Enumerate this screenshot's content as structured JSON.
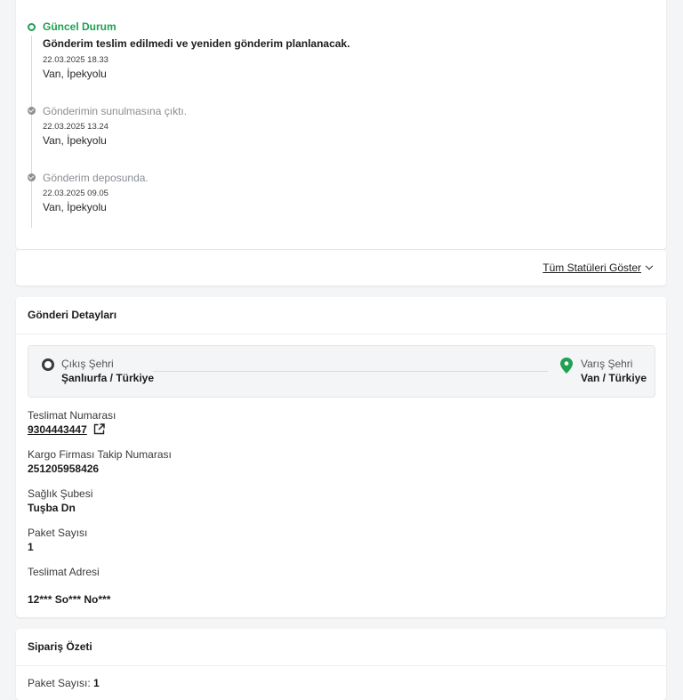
{
  "timeline": {
    "current": {
      "title": "Güncel Durum",
      "message": "Gönderim teslim edilmedi ve yeniden gönderim planlanacak.",
      "time": "22.03.2025 18.33",
      "location": "Van, İpekyolu"
    },
    "items": [
      {
        "title": "Gönderimin sunulmasına çıktı.",
        "time": "22.03.2025 13.24",
        "location": "Van, İpekyolu"
      },
      {
        "title": "Gönderim deposunda.",
        "time": "22.03.2025 09.05",
        "location": "Van, İpekyolu"
      }
    ]
  },
  "show_all_label": "Tüm Statüleri Göster",
  "details": {
    "header": "Gönderi Detayları",
    "origin_label": "Çıkış Şehri",
    "origin_value": "Şanlıurfa / Türkiye",
    "destination_label": "Varış Şehri",
    "destination_value": "Van / Türkiye",
    "fields": {
      "delivery_number_label": "Teslimat Numarası",
      "delivery_number_value": "9304443447",
      "tracking_label": "Kargo Firması Takip Numarası",
      "tracking_value": "251205958426",
      "branch_label": "Sağlık Şubesi",
      "branch_value": "Tuşba Dn",
      "package_count_label": "Paket Sayısı",
      "package_count_value": "1",
      "address_label": "Teslimat Adresi",
      "address_value": "12*** So*** No***"
    }
  },
  "summary": {
    "header": "Sipariş Özeti",
    "package_count_label": "Paket Sayısı:",
    "package_count_value": "1"
  },
  "colors": {
    "accent_green": "#20a052",
    "muted_gray": "#8d9095"
  },
  "icons": {
    "origin": "origin-ring-icon",
    "destination": "location-pin-icon",
    "external": "external-link-icon",
    "chevron": "chevron-down-icon"
  }
}
